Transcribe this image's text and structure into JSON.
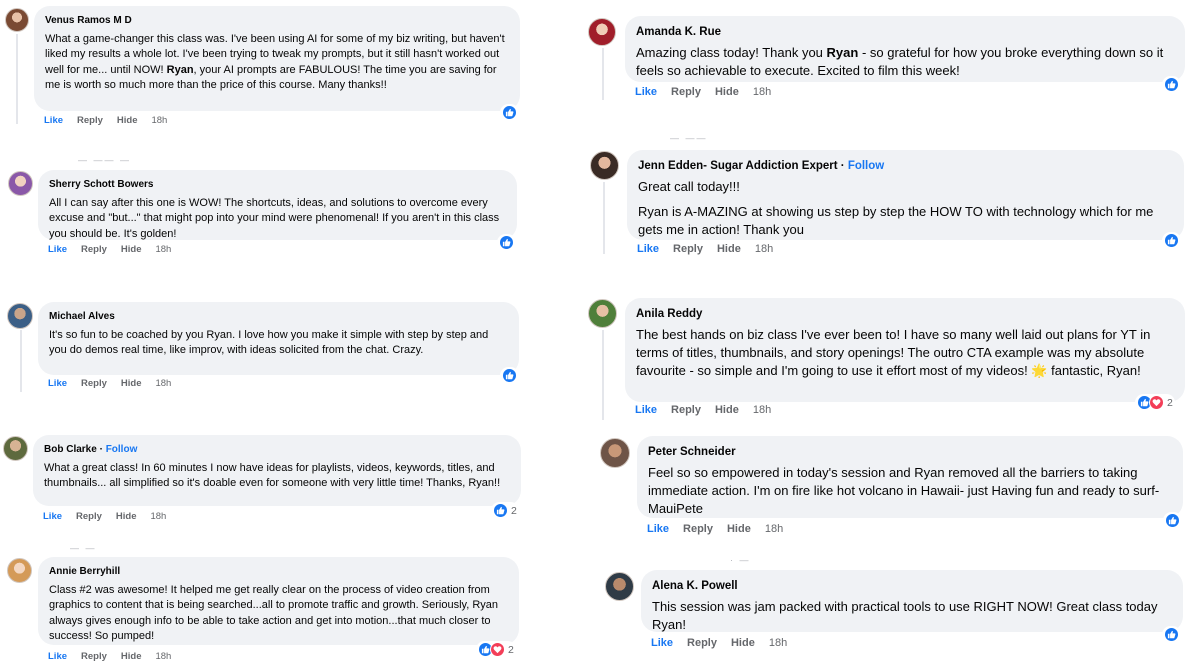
{
  "comments": [
    {
      "author": "Venus Ramos M D",
      "text_a": "What a game-changer this class was. I've been using AI for some of my biz writing, but haven't liked my results a whole lot. I've been trying to tweak my prompts, but it still hasn't worked out well for me... until NOW! ",
      "bold": "Ryan",
      "text_b": ", your AI prompts are FABULOUS! The time you are saving for me is worth so much more than the price of this course. Many thanks!!",
      "like": "Like",
      "reply": "Reply",
      "hide": "Hide",
      "time": "18h"
    },
    {
      "author": "Sherry Schott Bowers",
      "text": "All I can say after this one is WOW! The shortcuts, ideas, and solutions to overcome every excuse and \"but...\" that might pop into your mind were phenomenal! If you aren't in this class you should be. It's golden!",
      "like": "Like",
      "reply": "Reply",
      "hide": "Hide",
      "time": "18h"
    },
    {
      "author": "Michael Alves",
      "text": "It's so fun to be coached by you Ryan. I love how you make it simple with step by step and you do demos real time, like improv, with ideas solicited from the chat. Crazy.",
      "like": "Like",
      "reply": "Reply",
      "hide": "Hide",
      "time": "18h"
    },
    {
      "author": "Bob Clarke",
      "follow": "Follow",
      "text": "What a great class! In 60 minutes I now have ideas for playlists, videos, keywords, titles, and thumbnails... all simplified so it's doable even for someone with very little time! Thanks, Ryan!!",
      "like": "Like",
      "reply": "Reply",
      "hide": "Hide",
      "time": "18h",
      "reaction_count": "2"
    },
    {
      "author": "Annie Berryhill",
      "text": "Class #2 was awesome! It helped me get really clear on the process of video creation from graphics to content that is being searched...all to promote traffic and growth. Seriously, Ryan always gives enough info to be able to take action and get into motion...that much closer to success! So pumped!",
      "like": "Like",
      "reply": "Reply",
      "hide": "Hide",
      "time": "18h",
      "reaction_count": "2"
    },
    {
      "author": "Amanda K. Rue",
      "text_a": "Amazing class today! Thank you ",
      "bold": "Ryan",
      "text_b": " - so grateful for how you broke everything down so it feels so achievable to execute. Excited to film this week!",
      "like": "Like",
      "reply": "Reply",
      "hide": "Hide",
      "time": "18h"
    },
    {
      "author": "Jenn Edden- Sugar Addiction Expert",
      "follow": "Follow",
      "text_1": "Great call today!!!",
      "text_2": "Ryan is A-MAZING at showing us step by step the HOW TO with technology which for me gets me in action! Thank you",
      "like": "Like",
      "reply": "Reply",
      "hide": "Hide",
      "time": "18h"
    },
    {
      "author": "Anila Reddy",
      "text": "The best hands on biz class I've ever been to! I have so many well laid out plans for YT in terms of titles, thumbnails, and story openings! The outro CTA example was my absolute favourite - so simple and I'm going to use it effort most of my videos! 🌟 fantastic, Ryan!",
      "like": "Like",
      "reply": "Reply",
      "hide": "Hide",
      "time": "18h",
      "reaction_count": "2"
    },
    {
      "author": "Peter Schneider",
      "text": "Feel so so empowered in today's session and Ryan removed all the barriers to taking immediate action. I'm on fire like hot volcano in Hawaii- just Having fun and ready to surf-MauiPete",
      "like": "Like",
      "reply": "Reply",
      "hide": "Hide",
      "time": "18h"
    },
    {
      "author": "Alena K. Powell",
      "text": "This session was jam packed with practical tools to use RIGHT NOW! Great class today Ryan!",
      "like": "Like",
      "reply": "Reply",
      "hide": "Hide",
      "time": "18h"
    }
  ],
  "icons": {
    "like_reaction": "thumbs-up-icon",
    "love_reaction": "heart-icon"
  },
  "colors": {
    "bubble": "#f0f2f5",
    "link": "#1877f2",
    "meta": "#65676b",
    "love": "#f33e58"
  }
}
